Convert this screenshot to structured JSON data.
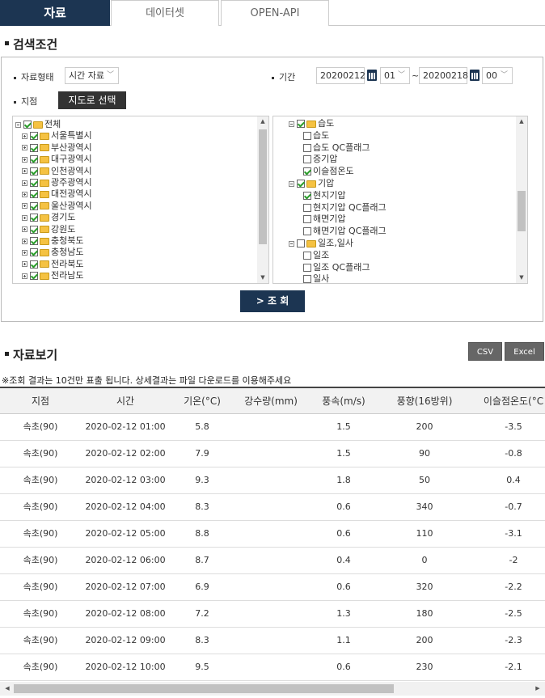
{
  "tabs": [
    "자료",
    "데이터셋",
    "OPEN-API"
  ],
  "search": {
    "title": "검색조건",
    "data_type_label": "자료형태",
    "data_type_value": "시간 자료",
    "period_label": "기간",
    "start_date": "20200212",
    "start_hour": "01",
    "tilde": "~",
    "end_date": "20200218",
    "end_hour": "00",
    "station_label": "지점",
    "map_button": "지도로 선택",
    "query_button": "> 조 회"
  },
  "stations_tree": [
    {
      "label": "전체",
      "checked": true,
      "root": true
    },
    {
      "label": "서울특별시",
      "checked": true
    },
    {
      "label": "부산광역시",
      "checked": true
    },
    {
      "label": "대구광역시",
      "checked": true
    },
    {
      "label": "인천광역시",
      "checked": true
    },
    {
      "label": "광주광역시",
      "checked": true
    },
    {
      "label": "대전광역시",
      "checked": true
    },
    {
      "label": "울산광역시",
      "checked": true
    },
    {
      "label": "경기도",
      "checked": true
    },
    {
      "label": "강원도",
      "checked": true
    },
    {
      "label": "충청북도",
      "checked": true
    },
    {
      "label": "충청남도",
      "checked": true
    },
    {
      "label": "전라북도",
      "checked": true
    },
    {
      "label": "전라남도",
      "checked": true
    }
  ],
  "elements_tree": [
    {
      "label": "습도",
      "checked": true,
      "group": true
    },
    {
      "label": "습도",
      "checked": false
    },
    {
      "label": "습도 QC플래그",
      "checked": false
    },
    {
      "label": "증기압",
      "checked": false
    },
    {
      "label": "이슬점온도",
      "checked": true
    },
    {
      "label": "기압",
      "checked": true,
      "group": true
    },
    {
      "label": "현지기압",
      "checked": true
    },
    {
      "label": "현지기압 QC플래그",
      "checked": false
    },
    {
      "label": "해면기압",
      "checked": false
    },
    {
      "label": "해면기압 QC플래그",
      "checked": false
    },
    {
      "label": "일조,일사",
      "checked": false,
      "group": true
    },
    {
      "label": "일조",
      "checked": false
    },
    {
      "label": "일조 QC플래그",
      "checked": false
    },
    {
      "label": "일사",
      "checked": false
    }
  ],
  "results": {
    "title": "자료보기",
    "csv_button": "CSV",
    "excel_button": "Excel",
    "note": "※조회 결과는 10건만 표출 됩니다. 상세결과는 파일 다운로드를 이용해주세요",
    "columns": [
      "지점",
      "시간",
      "기온(°C)",
      "강수량(mm)",
      "풍속(m/s)",
      "풍향(16방위)",
      "이슬점온도(°C"
    ],
    "rows": [
      [
        "속초(90)",
        "2020-02-12 01:00",
        "5.8",
        "",
        "1.5",
        "200",
        "-3.5"
      ],
      [
        "속초(90)",
        "2020-02-12 02:00",
        "7.9",
        "",
        "1.5",
        "90",
        "-0.8"
      ],
      [
        "속초(90)",
        "2020-02-12 03:00",
        "9.3",
        "",
        "1.8",
        "50",
        "0.4"
      ],
      [
        "속초(90)",
        "2020-02-12 04:00",
        "8.3",
        "",
        "0.6",
        "340",
        "-0.7"
      ],
      [
        "속초(90)",
        "2020-02-12 05:00",
        "8.8",
        "",
        "0.6",
        "110",
        "-3.1"
      ],
      [
        "속초(90)",
        "2020-02-12 06:00",
        "8.7",
        "",
        "0.4",
        "0",
        "-2"
      ],
      [
        "속초(90)",
        "2020-02-12 07:00",
        "6.9",
        "",
        "0.6",
        "320",
        "-2.2"
      ],
      [
        "속초(90)",
        "2020-02-12 08:00",
        "7.2",
        "",
        "1.3",
        "180",
        "-2.5"
      ],
      [
        "속초(90)",
        "2020-02-12 09:00",
        "8.3",
        "",
        "1.1",
        "200",
        "-2.3"
      ],
      [
        "속초(90)",
        "2020-02-12 10:00",
        "9.5",
        "",
        "0.6",
        "230",
        "-2.1"
      ]
    ]
  },
  "colors": {
    "primary": "#1c3552",
    "check": "#2a9d2a",
    "folder": "#f5c242"
  }
}
